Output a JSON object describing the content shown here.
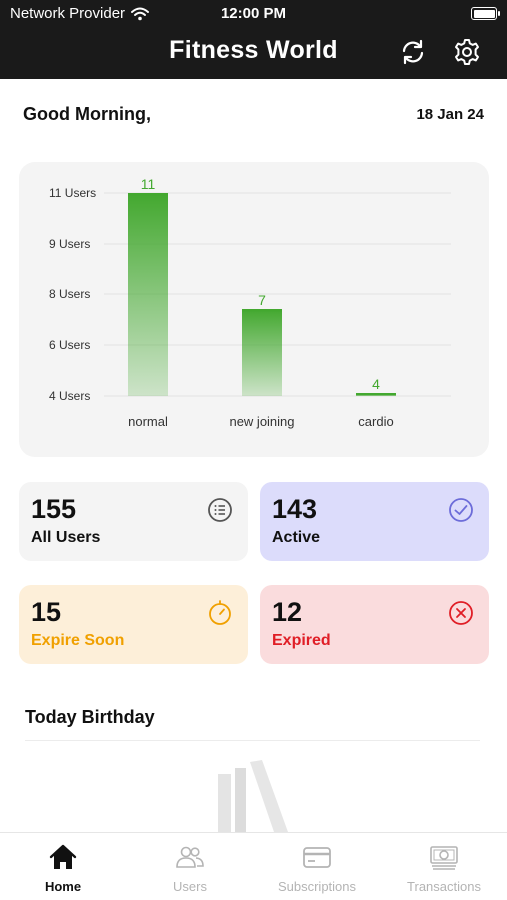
{
  "status_bar": {
    "carrier": "Network Provider",
    "time": "12:00 PM"
  },
  "header": {
    "title": "Fitness World",
    "refresh_icon": "refresh-icon",
    "settings_icon": "gear-icon"
  },
  "greeting": {
    "text": "Good Morning,",
    "date": "18 Jan 24"
  },
  "chart_data": {
    "type": "bar",
    "categories": [
      "normal",
      "new joining",
      "cardio"
    ],
    "values": [
      11,
      7,
      4
    ],
    "y_ticks": [
      "11 Users",
      "9 Users",
      "8 Users",
      "6 Users",
      "4 Users"
    ],
    "ylim": [
      4,
      11
    ],
    "grid": true,
    "bar_color": "#43a82f"
  },
  "stats": [
    {
      "value": "155",
      "label": "All Users",
      "icon": "list-icon",
      "bg": "#f4f4f4",
      "label_color": "#111111",
      "icon_color": "#555555"
    },
    {
      "value": "143",
      "label": "Active",
      "icon": "check-circle-icon",
      "bg": "#dcdcfb",
      "label_color": "#111111",
      "icon_color": "#6c6cd9"
    },
    {
      "value": "15",
      "label": "Expire Soon",
      "icon": "timer-icon",
      "bg": "#fdefd9",
      "label_color": "#f0a000",
      "icon_color": "#f0a000"
    },
    {
      "value": "12",
      "label": "Expired",
      "icon": "close-circle-icon",
      "bg": "#fadcdd",
      "label_color": "#e01e26",
      "icon_color": "#e01e26"
    }
  ],
  "birthday": {
    "title": "Today Birthday"
  },
  "tabs": [
    {
      "label": "Home",
      "icon": "home-icon",
      "active": true
    },
    {
      "label": "Users",
      "icon": "users-icon",
      "active": false
    },
    {
      "label": "Subscriptions",
      "icon": "card-icon",
      "active": false
    },
    {
      "label": "Transactions",
      "icon": "cash-icon",
      "active": false
    }
  ]
}
